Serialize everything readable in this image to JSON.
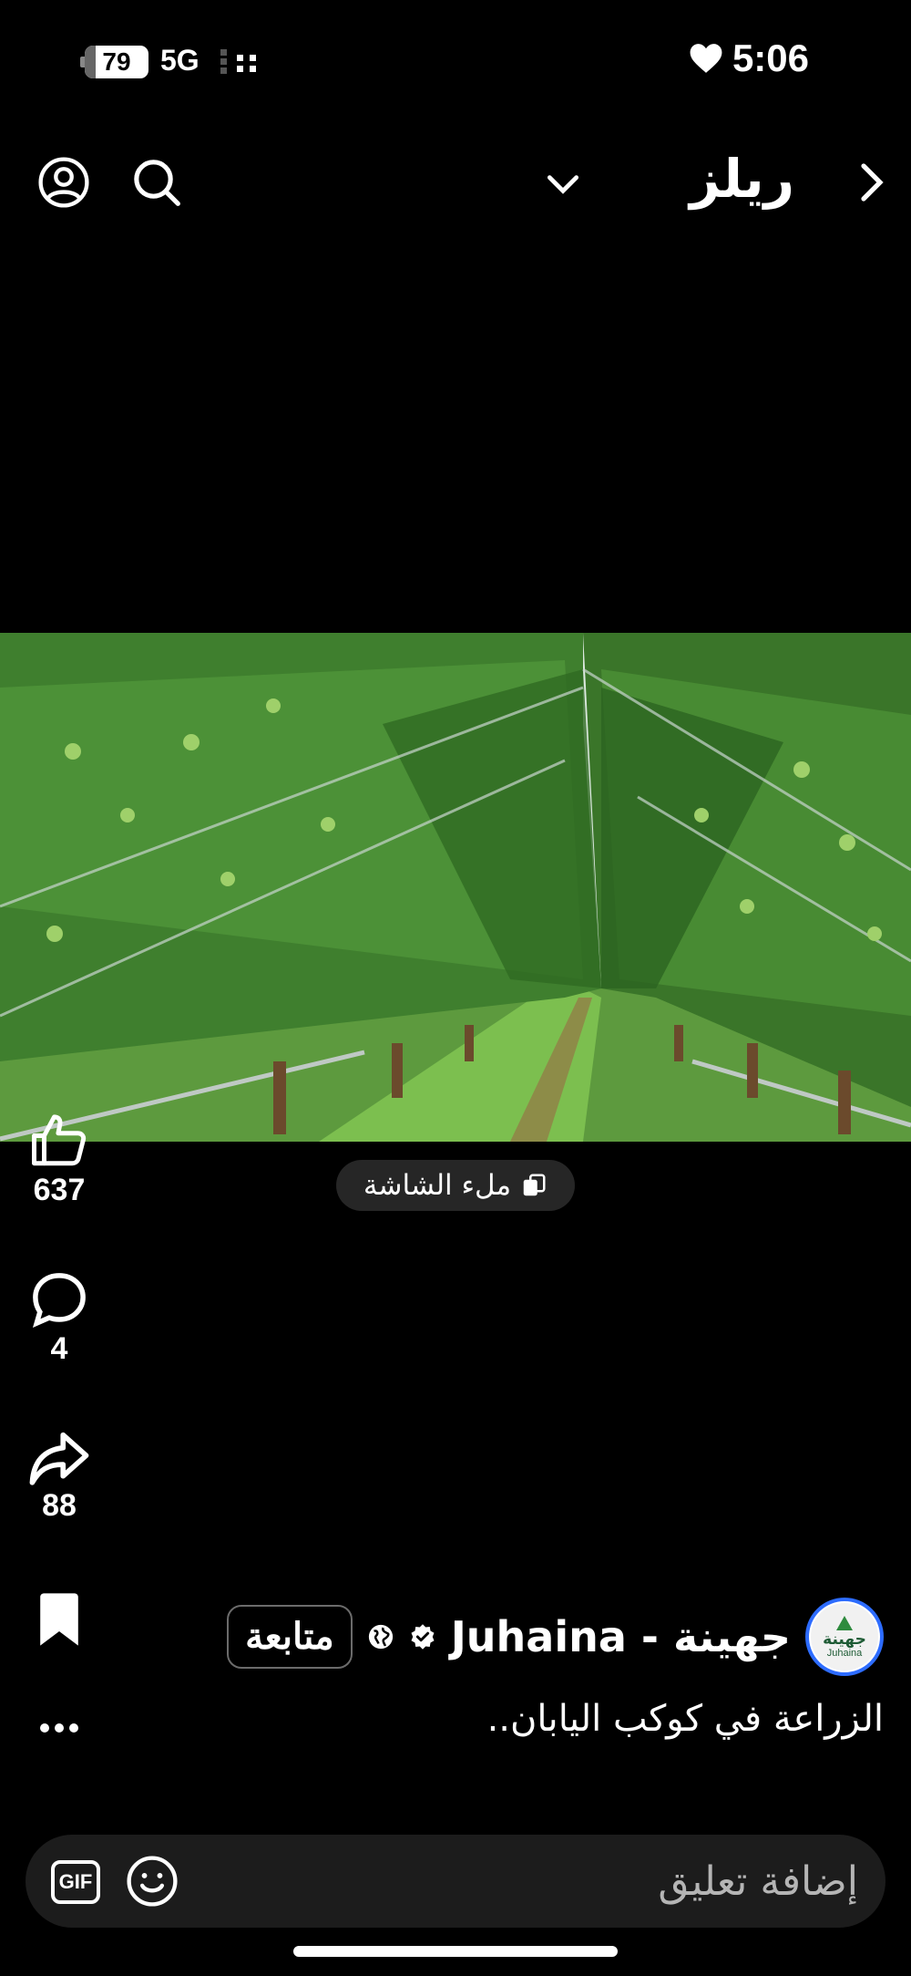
{
  "status": {
    "battery": "79",
    "network": "5G",
    "time": "5:06"
  },
  "header": {
    "title": "ريلز",
    "back_icon": "chevron-right-icon",
    "dropdown_icon": "chevron-down-icon",
    "profile_icon": "profile-icon",
    "search_icon": "search-icon"
  },
  "fullscreen": {
    "label": "ملء الشاشة"
  },
  "actions": {
    "likes": "637",
    "comments": "4",
    "shares": "88"
  },
  "author": {
    "name": "جهينة - Juhaina",
    "follow_label": "متابعة",
    "avatar_text": "جهينة",
    "avatar_sub": "Juhaina"
  },
  "caption": "الزراعة في كوكب اليابان..",
  "comment": {
    "placeholder": "إضافة تعليق",
    "gif_label": "GIF"
  },
  "colors": {
    "accent": "#2d6cff",
    "background": "#000000"
  }
}
